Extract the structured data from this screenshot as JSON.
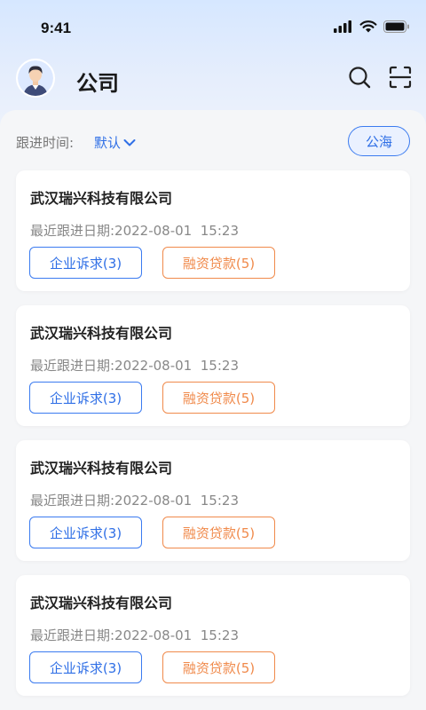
{
  "status_bar": {
    "time": "9:41"
  },
  "header": {
    "title": "公司",
    "avatar_icon": "user-avatar-icon",
    "search_icon": "search-icon",
    "scan_icon": "scan-icon"
  },
  "filter": {
    "label": "跟进时间:",
    "value": "默认",
    "sea_button": "公海"
  },
  "cards": [
    {
      "name": "武汉瑞兴科技有限公司",
      "date": "最近跟进日期:2022-08-01  15:23",
      "tag1": "企业诉求(3)",
      "tag2": "融资贷款(5)"
    },
    {
      "name": "武汉瑞兴科技有限公司",
      "date": "最近跟进日期:2022-08-01  15:23",
      "tag1": "企业诉求(3)",
      "tag2": "融资贷款(5)"
    },
    {
      "name": "武汉瑞兴科技有限公司",
      "date": "最近跟进日期:2022-08-01  15:23",
      "tag1": "企业诉求(3)",
      "tag2": "融资贷款(5)"
    },
    {
      "name": "武汉瑞兴科技有限公司",
      "date": "最近跟进日期:2022-08-01  15:23",
      "tag1": "企业诉求(3)",
      "tag2": "融资贷款(5)"
    }
  ],
  "colors": {
    "accent_blue": "#2f6fe6",
    "accent_orange": "#f08a4b"
  }
}
